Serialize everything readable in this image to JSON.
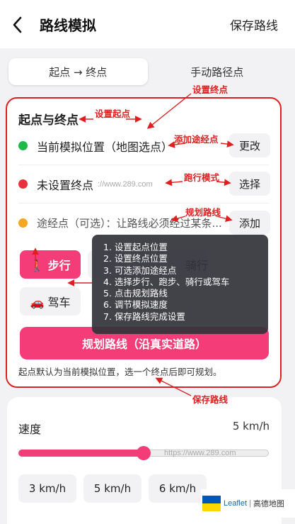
{
  "header": {
    "title": "路线模拟",
    "save_label": "保存路线"
  },
  "tabs": [
    {
      "label": "起点 → 终点",
      "active": true
    },
    {
      "label": "手动路径点",
      "active": false
    }
  ],
  "route": {
    "section_title": "起点与终点",
    "start_label": "当前模拟位置（地图选点）",
    "start_button": "更改",
    "end_label": "未设置终点",
    "end_button": "选择",
    "waypoint_label": "途经点（可选）：让路线必须经过某条...",
    "waypoint_button": "添加",
    "watermark": "://www.289.com"
  },
  "modes": {
    "walk": "🚶 步行",
    "ride": "骑行",
    "drive": "🚗 驾车"
  },
  "plan_button": "规划路线（沿真实道路）",
  "hint": "起点默认为当前模拟位置，选一个终点后即可规划。",
  "speed": {
    "label": "速度",
    "value_text": "5 km/h",
    "slider_fraction": 0.5,
    "watermark": "https://www.289.com",
    "presets": [
      "3 km/h",
      "5 km/h",
      "6 km/h"
    ]
  },
  "annotations": {
    "set_end": "设置终点",
    "set_start": "设置起点",
    "add_waypoint": "添加途经点",
    "run_mode": "跑行模式",
    "plan_route": "规划路线",
    "save_route": "保存路线"
  },
  "tooltip": {
    "steps": [
      "1. 设置起点位置",
      "2. 设置终点位置",
      "3. 可选添加途经点",
      "4. 选择步行、跑步、骑行或驾车",
      "5. 点击规划路线",
      "6. 调节模拟速度",
      "7. 保存路线完成设置"
    ]
  },
  "attribution": {
    "leaflet": "Leaflet",
    "separator": "|",
    "provider": "高德地图"
  },
  "colors": {
    "accent": "#f43d78",
    "start_dot": "#1fb84a",
    "end_dot": "#e8313b",
    "waypoint_dot": "#f5a623",
    "annotation": "#e02020"
  }
}
